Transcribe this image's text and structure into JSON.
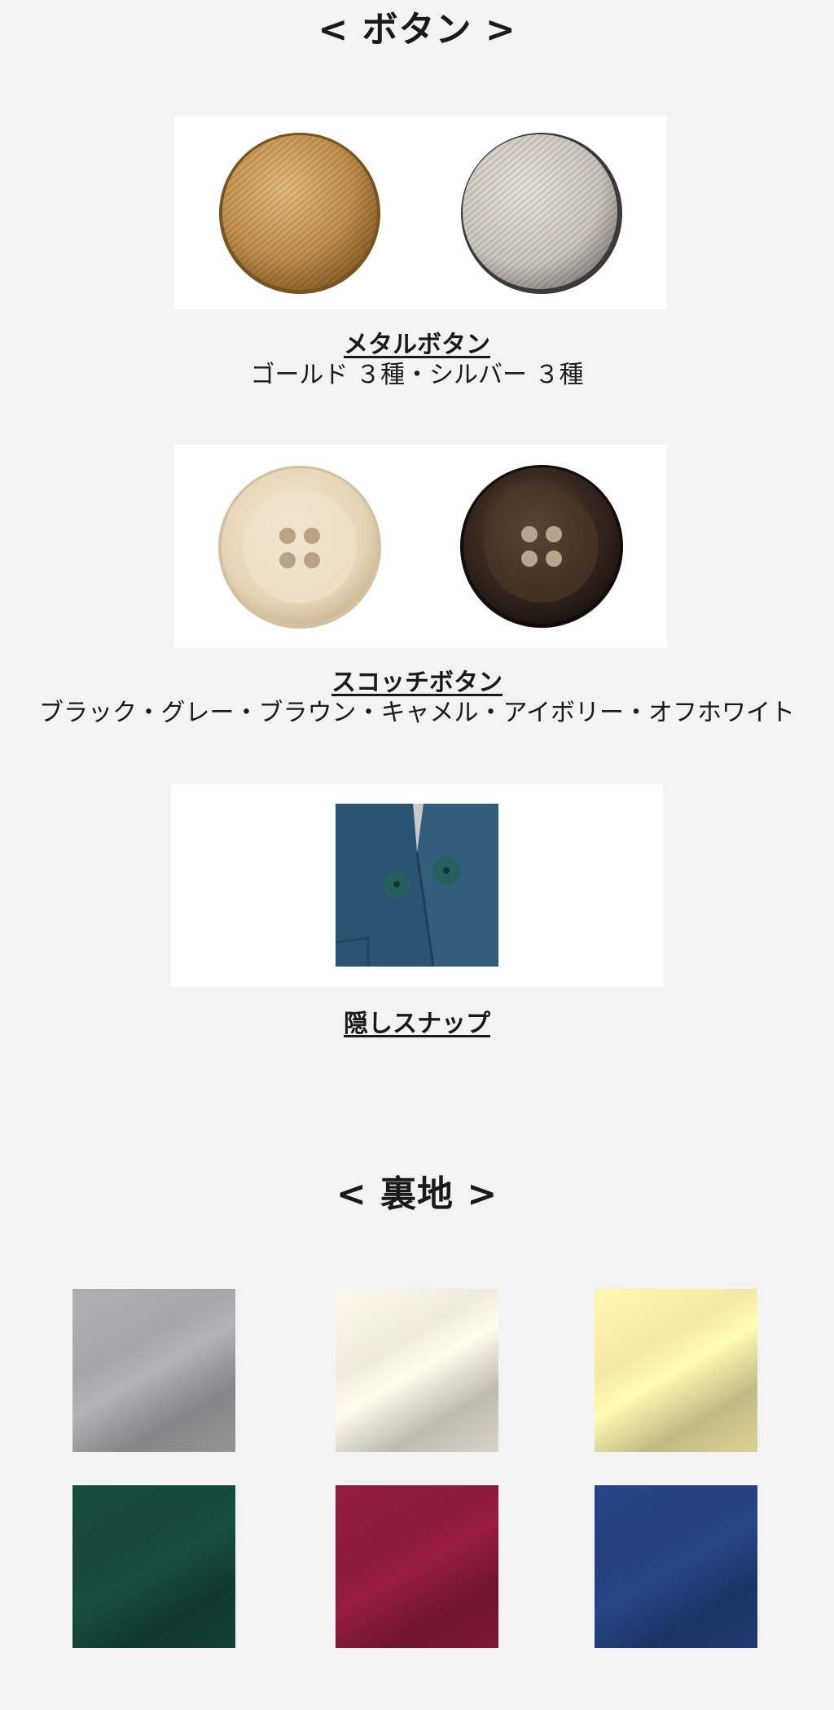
{
  "buttons_section": {
    "heading": "< ボタン >",
    "items": [
      {
        "title": "メタルボタン",
        "subtitle": "ゴールド ３種・シルバー ３種",
        "swatch_icons": [
          "gold-metal-button-icon",
          "silver-metal-button-icon"
        ]
      },
      {
        "title": "スコッチボタン",
        "subtitle": "ブラック・グレー・ブラウン・キャメル・アイボリー・オフホワイト",
        "swatch_icons": [
          "ivory-scotch-button-icon",
          "brown-scotch-button-icon"
        ]
      },
      {
        "title": "隠しスナップ",
        "swatch_icons": [
          "hidden-snap-icon"
        ]
      }
    ]
  },
  "lining_section": {
    "heading": "< 裏地 >",
    "swatches": [
      {
        "icon": "gray-lining-swatch",
        "color": "#a6a5a7"
      },
      {
        "icon": "offwhite-lining-swatch",
        "color": "#efeadc"
      },
      {
        "icon": "yellow-lining-swatch",
        "color": "#f3e9a6"
      },
      {
        "icon": "green-lining-swatch",
        "color": "#15493a"
      },
      {
        "icon": "red-lining-swatch",
        "color": "#8c1a3c"
      },
      {
        "icon": "navy-lining-swatch",
        "color": "#23417e"
      }
    ]
  }
}
